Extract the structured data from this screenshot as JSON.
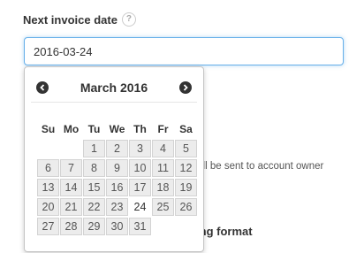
{
  "field": {
    "label": "Next invoice date",
    "help_glyph": "?",
    "value": "2016-03-24"
  },
  "background": {
    "partial_text_1": "ill be sent to account owner",
    "partial_text_2": "ring format"
  },
  "datepicker": {
    "title": "March 2016",
    "prev_icon": "chevron-left-icon",
    "next_icon": "chevron-right-icon",
    "weekdays": [
      "Su",
      "Mo",
      "Tu",
      "We",
      "Th",
      "Fr",
      "Sa"
    ],
    "leading_blanks": 2,
    "days": [
      "1",
      "2",
      "3",
      "4",
      "5",
      "6",
      "7",
      "8",
      "9",
      "10",
      "11",
      "12",
      "13",
      "14",
      "15",
      "16",
      "17",
      "18",
      "19",
      "20",
      "21",
      "22",
      "23",
      "24",
      "25",
      "26",
      "27",
      "28",
      "29",
      "30",
      "31"
    ],
    "selected_day": "24"
  }
}
